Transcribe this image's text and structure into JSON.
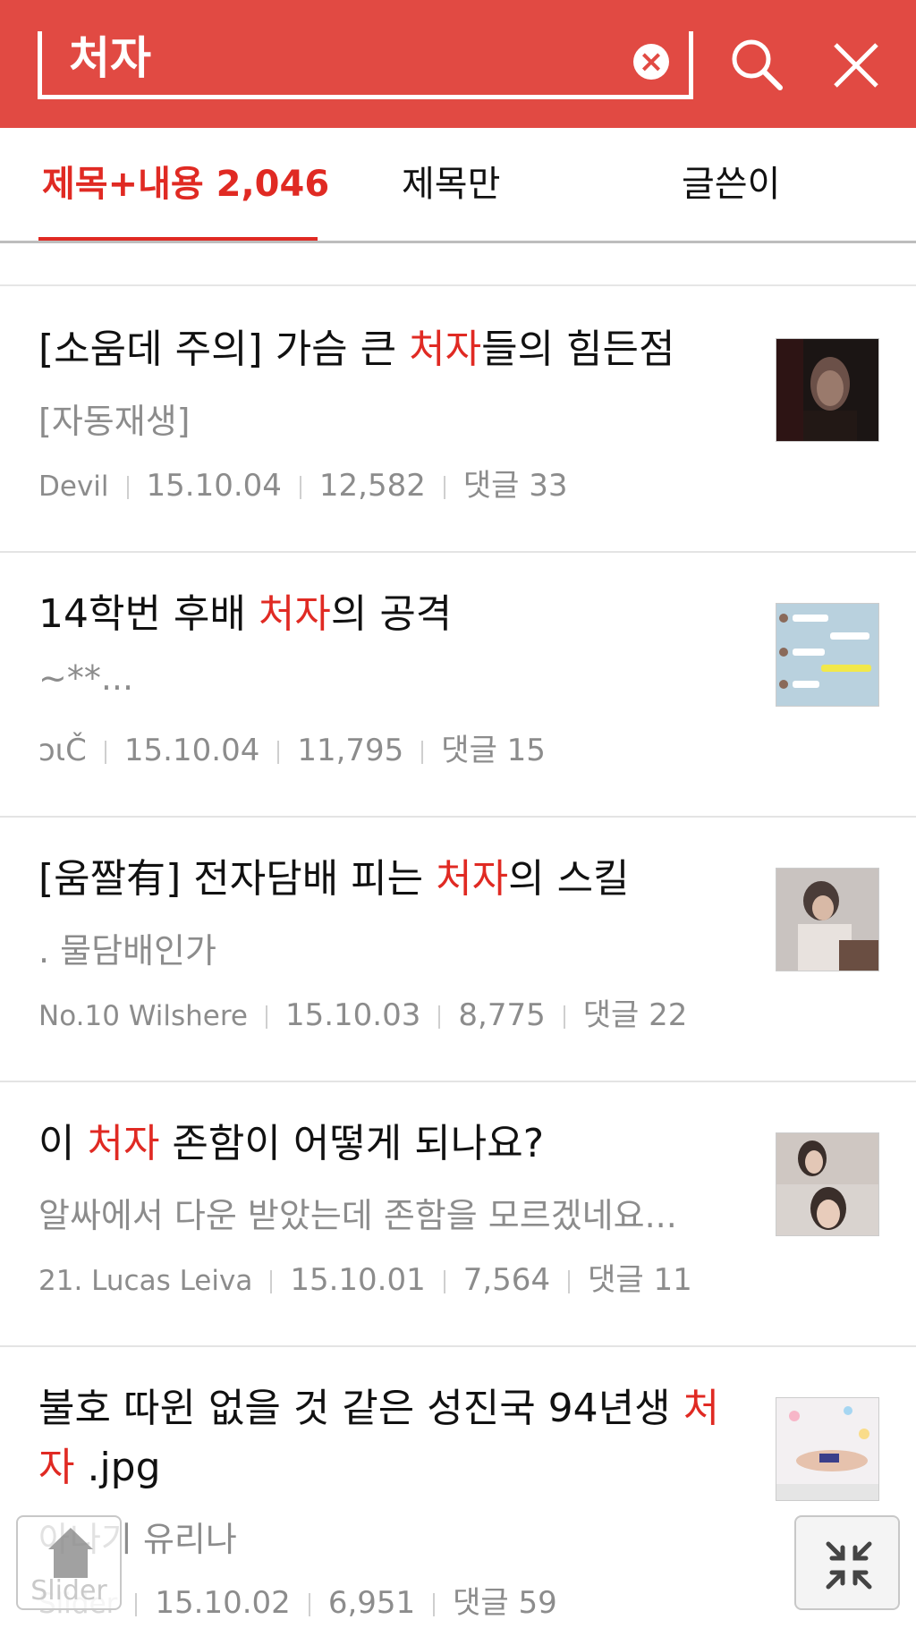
{
  "search": {
    "query": "처자",
    "clear_icon": "clear-icon",
    "search_icon": "search-icon",
    "close_icon": "close-icon"
  },
  "tabs": [
    {
      "label": "제목+내용 2,046",
      "active": true
    },
    {
      "label": "제목만",
      "active": false
    },
    {
      "label": "글쓴이",
      "active": false
    }
  ],
  "posts": [
    {
      "title_before": "[소움데 주의] 가슴 큰 ",
      "title_highlight": "처자",
      "title_after": "들의 힘든점",
      "subtitle": "[자동재생]",
      "author": "Devil",
      "date": "15.10.04",
      "views": "12,582",
      "comments": "댓글 33"
    },
    {
      "title_before": "14학번 후배 ",
      "title_highlight": "처자",
      "title_after": "의 공격",
      "subtitle": "~**...",
      "author": "ɔιČ",
      "date": "15.10.04",
      "views": "11,795",
      "comments": "댓글 15"
    },
    {
      "title_before": "[움짤有] 전자담배 피는 ",
      "title_highlight": "처자",
      "title_after": "의 스킬",
      "subtitle": ". 물담배인가",
      "author": "No.10 Wilshere",
      "date": "15.10.03",
      "views": "8,775",
      "comments": "댓글 22"
    },
    {
      "title_before": "이 ",
      "title_highlight": "처자",
      "title_after": " 존함이 어떻게 되나요?",
      "subtitle": "알싸에서 다운 받았는데 존함을 모르겠네요...",
      "author": "21. Lucas Leiva",
      "date": "15.10.01",
      "views": "7,564",
      "comments": "댓글 11"
    },
    {
      "title_before": "불호 따윈 없을 것 같은 성진국 94년생 ",
      "title_highlight": "처자",
      "title_after": " .jpg",
      "subtitle": "아나기 유리나",
      "author": "Slider",
      "date": "15.10.02",
      "views": "6,951",
      "comments": "댓글 59"
    }
  ],
  "floating": {
    "home_icon": "home-icon",
    "home_label": "Slider",
    "collapse_icon": "collapse-icon"
  }
}
